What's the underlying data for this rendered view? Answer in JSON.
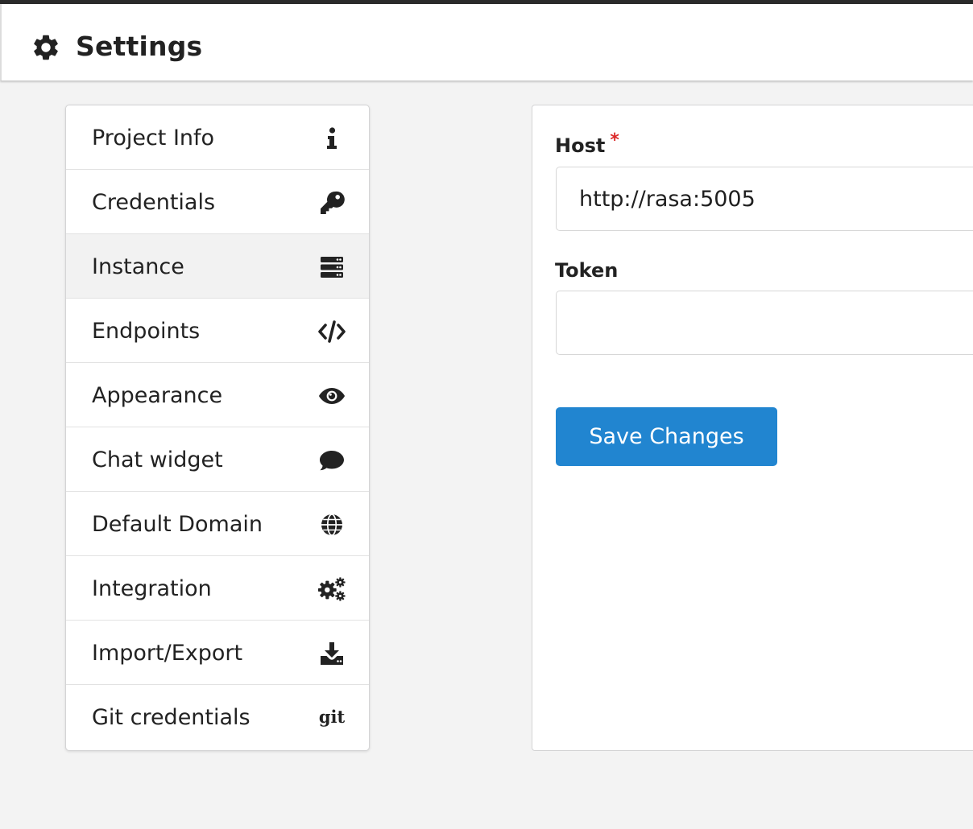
{
  "header": {
    "title": "Settings",
    "icon": "gear-icon"
  },
  "menu": {
    "active_index": 2,
    "items": [
      {
        "label": "Project Info",
        "icon": "info-icon"
      },
      {
        "label": "Credentials",
        "icon": "key-icon"
      },
      {
        "label": "Instance",
        "icon": "server-icon"
      },
      {
        "label": "Endpoints",
        "icon": "code-icon"
      },
      {
        "label": "Appearance",
        "icon": "eye-icon"
      },
      {
        "label": "Chat widget",
        "icon": "comment-icon"
      },
      {
        "label": "Default Domain",
        "icon": "globe-icon"
      },
      {
        "label": "Integration",
        "icon": "cogs-icon"
      },
      {
        "label": "Import/Export",
        "icon": "download-icon"
      },
      {
        "label": "Git credentials",
        "icon": "git-icon",
        "icon_text": "git"
      }
    ]
  },
  "form": {
    "host": {
      "label": "Host",
      "required_mark": "*",
      "value": "http://rasa:5005"
    },
    "token": {
      "label": "Token",
      "value": ""
    },
    "save_label": "Save Changes"
  },
  "colors": {
    "primary": "#2185d0",
    "required": "#db2828",
    "active_item_bg": "#f2f2f2"
  }
}
